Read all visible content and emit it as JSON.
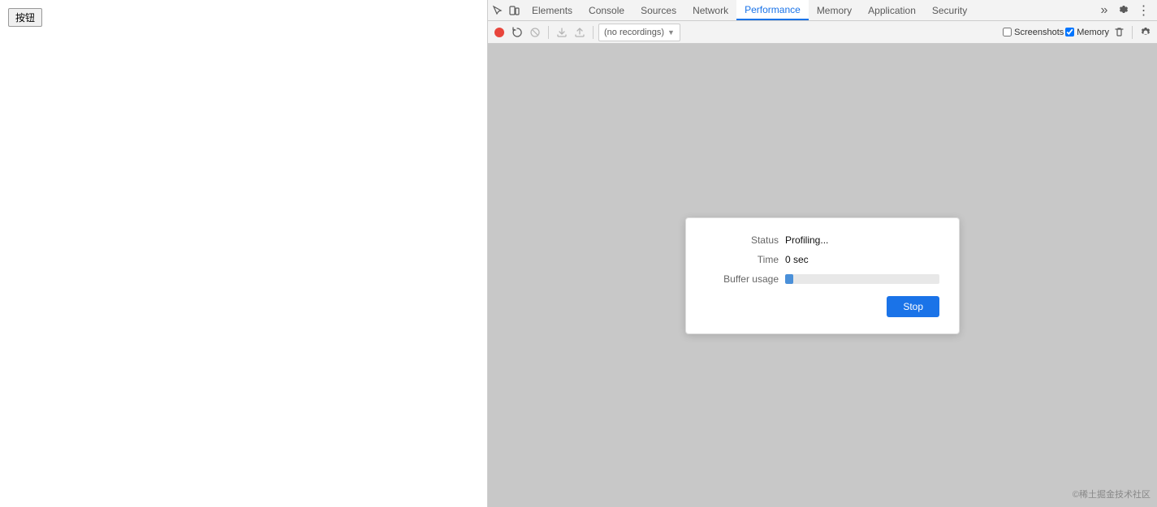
{
  "page": {
    "button_label": "按钮"
  },
  "devtools": {
    "tabs": [
      {
        "id": "elements",
        "label": "Elements",
        "active": false
      },
      {
        "id": "console",
        "label": "Console",
        "active": false
      },
      {
        "id": "sources",
        "label": "Sources",
        "active": false
      },
      {
        "id": "network",
        "label": "Network",
        "active": false
      },
      {
        "id": "performance",
        "label": "Performance",
        "active": true
      },
      {
        "id": "memory",
        "label": "Memory",
        "active": false
      },
      {
        "id": "application",
        "label": "Application",
        "active": false
      },
      {
        "id": "security",
        "label": "Security",
        "active": false
      }
    ],
    "toolbar": {
      "recordings_placeholder": "(no recordings)",
      "screenshots_label": "Screenshots",
      "memory_label": "Memory"
    },
    "dialog": {
      "status_label": "Status",
      "status_value": "Profiling...",
      "time_label": "Time",
      "time_value": "0 sec",
      "buffer_label": "Buffer usage",
      "buffer_percent": 5,
      "stop_label": "Stop"
    }
  },
  "watermark": {
    "text": "©稀土掘金技术社区"
  }
}
